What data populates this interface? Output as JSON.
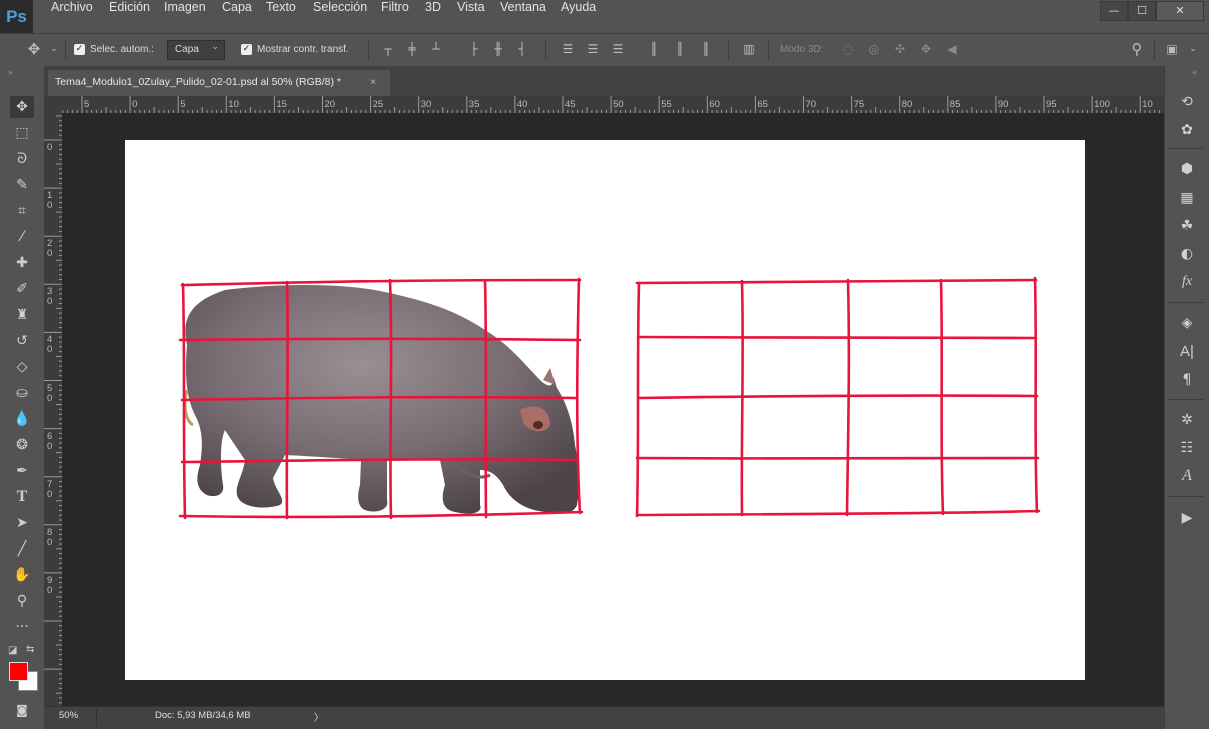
{
  "app": {
    "logo": "Ps"
  },
  "menu": [
    "Archivo",
    "Edición",
    "Imagen",
    "Capa",
    "Texto",
    "Selección",
    "Filtro",
    "3D",
    "Vista",
    "Ventana",
    "Ayuda"
  ],
  "window_controls": {
    "minimize": "—",
    "maximize": "☐",
    "close": "✕"
  },
  "options": {
    "auto_select_label": "Selec. autom.:",
    "auto_select_value": "Capa",
    "show_transform_label": "Mostrar contr. transf.",
    "mode3d_label": "Modo 3D:"
  },
  "document": {
    "tab_title": "Tema4_Modulo1_0Zulay_Pulido_02-01.psd al 50% (RGB/8) *",
    "tab_close": "×"
  },
  "ruler": {
    "h_labels": [
      "5",
      "0",
      "5",
      "10",
      "15",
      "20",
      "25",
      "30",
      "35",
      "40",
      "45",
      "50",
      "55",
      "60",
      "65",
      "70",
      "75",
      "80",
      "85",
      "90",
      "95",
      "100",
      "10"
    ],
    "v_labels": [
      "0",
      "1 0",
      "2 0",
      "3 0",
      "4 0",
      "5 0",
      "6 0",
      "7 0",
      "8 0",
      "9 0"
    ]
  },
  "status": {
    "zoom": "50%",
    "doc_info": "Doc: 5,93 MB/34,6 MB",
    "arrow": "〉"
  },
  "colors": {
    "foreground": "#ff0000",
    "background": "#ffffff",
    "grid_line": "#e8143c",
    "ui_bg": "#535353"
  },
  "canvas": {
    "left_image": "hippopotamus-photo",
    "grid_cols": 4,
    "grid_rows": 4
  },
  "tools": [
    "move-icon",
    "marquee-icon",
    "lasso-icon",
    "quick-select-icon",
    "crop-icon",
    "eyedropper-icon",
    "healing-icon",
    "brush-icon",
    "stamp-icon",
    "history-brush-icon",
    "eraser-icon",
    "paint-bucket-icon",
    "dodge-icon",
    "sponge-icon",
    "pen-icon",
    "type-icon",
    "path-select-icon",
    "line-icon",
    "hand-icon",
    "zoom-icon",
    "more-tools-icon"
  ],
  "panels": [
    "history-icon",
    "color-wheel-icon",
    "cube-3d-icon",
    "swatches-icon",
    "palette-icon",
    "adjustments-icon",
    "fx-icon",
    "layers-icon",
    "character-icon",
    "paragraph-icon",
    "brush-settings-icon",
    "properties-icon",
    "glyphs-icon",
    "play-icon"
  ]
}
